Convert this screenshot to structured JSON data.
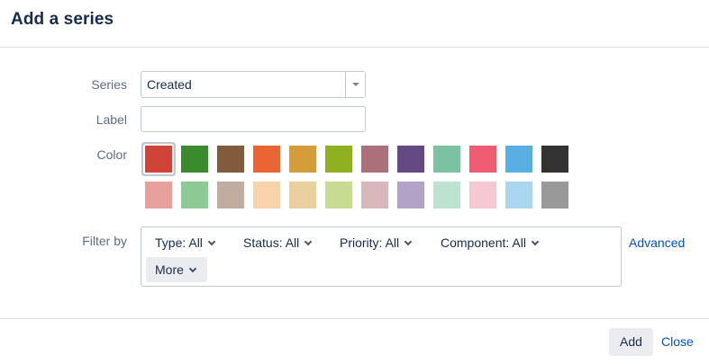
{
  "dialog": {
    "title": "Add a series"
  },
  "form": {
    "series": {
      "label": "Series",
      "value": "Created"
    },
    "label_field": {
      "label": "Label",
      "value": "",
      "placeholder": ""
    },
    "color": {
      "label": "Color",
      "selected_index": 0,
      "swatches": [
        "#d04437",
        "#3b8a2e",
        "#815b3a",
        "#eb6433",
        "#d59c3b",
        "#8eb021",
        "#ac707a",
        "#654982",
        "#7ac2a2",
        "#f15c75",
        "#59afe1",
        "#333333",
        "#e8a19a",
        "#8cc994",
        "#c2aca0",
        "#f9d3ab",
        "#e9d09d",
        "#c8db92",
        "#d9b8bd",
        "#b3a2c7",
        "#bde3d0",
        "#f5c8d3",
        "#aad6f0",
        "#999999"
      ]
    },
    "filter": {
      "label": "Filter by",
      "buttons": [
        {
          "label": "Type: All"
        },
        {
          "label": "Status: All"
        },
        {
          "label": "Priority: All"
        },
        {
          "label": "Component: All"
        },
        {
          "label": "More"
        }
      ],
      "advanced_label": "Advanced"
    }
  },
  "footer": {
    "add_label": "Add",
    "close_label": "Close"
  }
}
